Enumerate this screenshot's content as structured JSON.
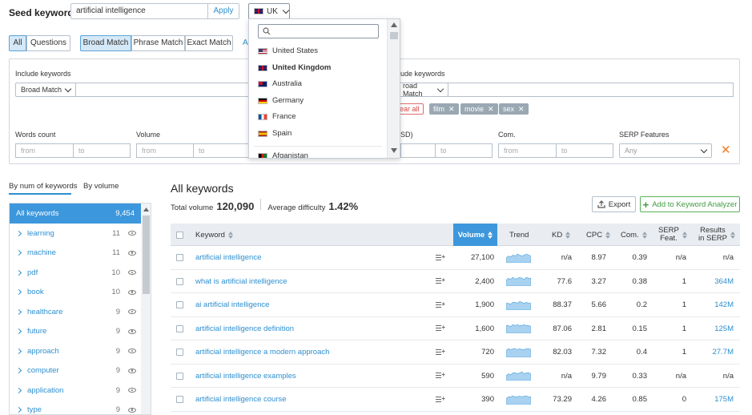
{
  "header": {
    "seed_label": "Seed keyword:",
    "seed_value": "artificial intelligence",
    "apply_label": "Apply",
    "database_label": "UK"
  },
  "match_tabs": {
    "all": "All",
    "questions": "Questions",
    "broad": "Broad Match",
    "phrase": "Phrase Match",
    "exact": "Exact Match",
    "more": "A"
  },
  "dropdown": {
    "items": [
      {
        "label": "United States",
        "flag": "us"
      },
      {
        "label": "United Kingdom",
        "flag": "uk",
        "selected": true
      },
      {
        "label": "Australia",
        "flag": "au"
      },
      {
        "label": "Germany",
        "flag": "de"
      },
      {
        "label": "France",
        "flag": "fr"
      },
      {
        "label": "Spain",
        "flag": "es"
      },
      {
        "label": "Afganistan",
        "flag": "af"
      }
    ]
  },
  "filters": {
    "include_label": "Include keywords",
    "include_match": "Broad Match",
    "exclude_label": "ude keywords",
    "exclude_match": "road Match",
    "clear_all": "lear all",
    "tags": [
      "film",
      "movie",
      "sex"
    ],
    "words_count_label": "Words count",
    "volume_label": "Volume",
    "cpc_label": "SD)",
    "com_label": "Com.",
    "serp_label": "SERP Features",
    "from_placeholder": "from",
    "to_placeholder": "to",
    "serp_value": "Any"
  },
  "left_panel": {
    "tab_by_num": "By num of keywords",
    "tab_by_volume": "By volume",
    "all_label": "All keywords",
    "all_count": "9,454",
    "groups": [
      {
        "name": "learning",
        "count": "11"
      },
      {
        "name": "machine",
        "count": "11"
      },
      {
        "name": "pdf",
        "count": "10"
      },
      {
        "name": "book",
        "count": "10"
      },
      {
        "name": "healthcare",
        "count": "9"
      },
      {
        "name": "future",
        "count": "9"
      },
      {
        "name": "approach",
        "count": "9"
      },
      {
        "name": "computer",
        "count": "9"
      },
      {
        "name": "application",
        "count": "9"
      },
      {
        "name": "type",
        "count": "9"
      }
    ]
  },
  "main": {
    "title": "All keywords",
    "total_volume_label": "Total volume",
    "total_volume": "120,090",
    "avg_difficulty_label": "Average difficulty",
    "avg_difficulty": "1.42%",
    "export_label": "Export",
    "add_label": "Add to Keyword Analyzer"
  },
  "table": {
    "headers": {
      "keyword": "Keyword",
      "volume": "Volume",
      "trend": "Trend",
      "kd": "KD",
      "cpc": "CPC",
      "com": "Com.",
      "serp_feat_1": "SERP",
      "serp_feat_2": "Feat.",
      "results_1": "Results",
      "results_2": "in SERP"
    },
    "rows": [
      {
        "keyword": "artificial intelligence",
        "volume": "27,100",
        "kd": "n/a",
        "cpc": "8.97",
        "com": "0.39",
        "serp": "n/a",
        "results": "n/a",
        "trend": [
          5,
          7,
          6,
          8,
          7,
          9,
          8,
          7,
          8,
          9,
          8,
          7
        ]
      },
      {
        "keyword": "what is artificial intelligence",
        "volume": "2,400",
        "kd": "77.6",
        "cpc": "3.27",
        "com": "0.38",
        "serp": "1",
        "results": "364M",
        "trend": [
          6,
          8,
          7,
          9,
          7,
          8,
          9,
          8,
          7,
          9,
          8,
          8
        ]
      },
      {
        "keyword": "ai artificial intelligence",
        "volume": "1,900",
        "kd": "88.37",
        "cpc": "5.66",
        "com": "0.2",
        "serp": "1",
        "results": "142M",
        "trend": [
          7,
          7,
          6,
          8,
          8,
          7,
          9,
          8,
          7,
          8,
          7,
          7
        ]
      },
      {
        "keyword": "artificial intelligence definition",
        "volume": "1,600",
        "kd": "87.06",
        "cpc": "2.81",
        "com": "0.15",
        "serp": "1",
        "results": "125M",
        "trend": [
          8,
          8,
          7,
          9,
          8,
          9,
          8,
          8,
          9,
          8,
          8,
          7
        ]
      },
      {
        "keyword": "artificial intelligence a modern approach",
        "volume": "720",
        "kd": "82.03",
        "cpc": "7.32",
        "com": "0.4",
        "serp": "1",
        "results": "27.7M",
        "trend": [
          7,
          9,
          8,
          9,
          9,
          8,
          9,
          8,
          8,
          9,
          9,
          8
        ]
      },
      {
        "keyword": "artificial intelligence examples",
        "volume": "590",
        "kd": "n/a",
        "cpc": "9.79",
        "com": "0.33",
        "serp": "n/a",
        "results": "n/a",
        "trend": [
          5,
          7,
          6,
          8,
          8,
          7,
          8,
          9,
          7,
          8,
          8,
          7
        ]
      },
      {
        "keyword": "artificial intelligence course",
        "volume": "390",
        "kd": "73.29",
        "cpc": "4.26",
        "com": "0.85",
        "serp": "0",
        "results": "175M",
        "trend": [
          6,
          8,
          8,
          9,
          8,
          8,
          9,
          8,
          9,
          9,
          8,
          8
        ]
      }
    ]
  }
}
